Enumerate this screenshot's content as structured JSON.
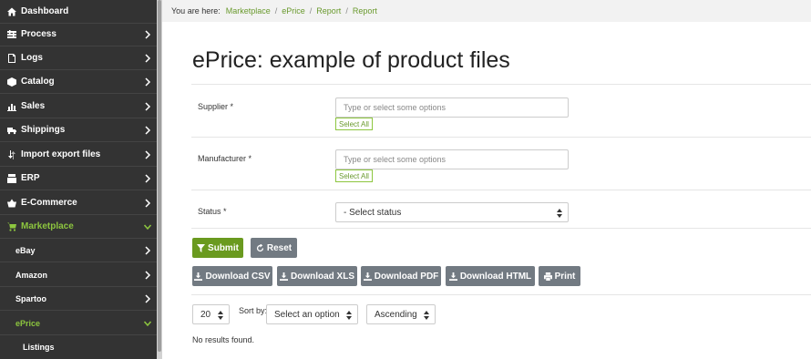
{
  "sidebar": {
    "items": [
      {
        "label": "Dashboard",
        "icon": "home-icon"
      },
      {
        "label": "Process",
        "icon": "process-icon"
      },
      {
        "label": "Logs",
        "icon": "logs-icon"
      },
      {
        "label": "Catalog",
        "icon": "catalog-icon"
      },
      {
        "label": "Sales",
        "icon": "sales-chart-icon"
      },
      {
        "label": "Shippings",
        "icon": "truck-icon"
      },
      {
        "label": "Import export files",
        "icon": "import-export-icon"
      },
      {
        "label": "ERP",
        "icon": "erp-icon"
      },
      {
        "label": "E-Commerce",
        "icon": "basket-icon"
      },
      {
        "label": "Marketplace",
        "icon": "cart-icon"
      }
    ],
    "subitems": [
      {
        "label": "eBay"
      },
      {
        "label": "Amazon"
      },
      {
        "label": "Spartoo"
      },
      {
        "label": "ePrice"
      }
    ],
    "subsubitems": [
      {
        "label": "Listings"
      }
    ],
    "active_color": "#8dc63f"
  },
  "breadcrumb": {
    "prefix": "You are here:",
    "items": [
      "Marketplace",
      "ePrice",
      "Report",
      "Report"
    ],
    "separator": "/"
  },
  "page": {
    "title": "ePrice: example of product files"
  },
  "form": {
    "supplier": {
      "label": "Supplier *",
      "placeholder": "Type or select some options",
      "select_all": "Select All"
    },
    "manufacturer": {
      "label": "Manufacturer *",
      "placeholder": "Type or select some options",
      "select_all": "Select All"
    },
    "status": {
      "label": "Status *",
      "value": "- Select status"
    }
  },
  "buttons": {
    "submit": "Submit",
    "reset": "Reset",
    "download_csv": "Download CSV",
    "download_xls": "Download XLS",
    "download_pdf": "Download PDF",
    "download_html": "Download HTML",
    "print": "Print"
  },
  "list_controls": {
    "page_size": "20",
    "sort_by_label": "Sort by:",
    "sort_field": "Select an option",
    "sort_order": "Ascending"
  },
  "results": {
    "empty_text": "No results found."
  },
  "colors": {
    "sidebar_bg": "#333333",
    "accent_green": "#8dc63f",
    "button_green": "#6a9a1f",
    "button_grey": "#727a82"
  }
}
